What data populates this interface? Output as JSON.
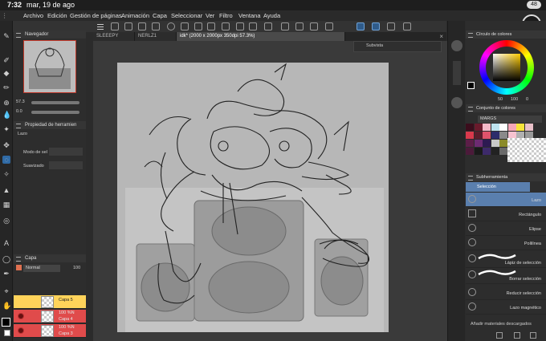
{
  "status": {
    "time": "7:32",
    "date": "mar, 19 de ago",
    "battery": "48"
  },
  "menu": [
    "Archivo",
    "Edición",
    "Gestión de páginas",
    "Animación",
    "Capa",
    "Seleccionar",
    "Ver",
    "Filtro",
    "Ventana",
    "Ayuda"
  ],
  "navigator": {
    "title": "Navegador",
    "zoom": "57.3",
    "rotation": "0.0"
  },
  "tool_property": {
    "title": "Propiedad de herramien",
    "tool_name": "Lazo",
    "mode_label": "Modo de sel",
    "smooth_label": "Suavizado"
  },
  "layers": {
    "title": "Capa",
    "blend_mode": "Normal",
    "opacity": "100",
    "rows": [
      {
        "name": "Capa 5",
        "opacity_label": ""
      },
      {
        "name": "Capa 4",
        "opacity_label": "100 %N"
      },
      {
        "name": "Capa 3",
        "opacity_label": "100 %N"
      }
    ]
  },
  "tabs": [
    {
      "label": "SLEEEPY",
      "active": false
    },
    {
      "label": "NERLZ1",
      "active": false
    },
    {
      "label": "idk* (2000 x 2000px 350dpi 57.3%)",
      "active": true
    }
  ],
  "subview": {
    "label": "Subvista"
  },
  "color_wheel": {
    "title": "Círculo de colores",
    "h": "50",
    "s": "100",
    "v": "0"
  },
  "color_set": {
    "title": "Conjunto de colores",
    "set_name": "MARGS",
    "swatches": [
      "#3b0d1c",
      "#6a1a2c",
      "#f3b8c7",
      "#bde3f0",
      "#ffffff",
      "#f6a7b8",
      "#f7e43a",
      "#e9c0c9",
      "#d9394c",
      "#5a1c2b",
      "#e0536b",
      "#2c2c6b",
      "#8a8a8a",
      "#f7c3d0",
      "#b0b0b0",
      "#999999",
      "#5c1e48",
      "#6d2b72",
      "#2d1a52",
      "#c9c9c9",
      "#8b8b2a",
      "#bfe86a",
      "#cccccc",
      "#aaaaaa",
      "#4b1a3a",
      "#1a1a1a",
      "#3d2a6a",
      "#222222",
      "#6a6a6a",
      "#9a6b3a",
      "#dddddd",
      "#bbbbbb"
    ]
  },
  "sub_tool": {
    "title": "Subherramienta",
    "group": "Selección",
    "items": [
      "Lazo",
      "Rectángulo",
      "Elipse",
      "Polilínea",
      "Lápiz de selección",
      "Borrar selección",
      "Reducir selección",
      "Lazo magnético"
    ],
    "selected": "Lazo",
    "footer": "Añadir materiales descargados"
  },
  "colors": {
    "accent": "#2f6aa5",
    "selection": "#5a7fae",
    "layer_red": "#e04b4b",
    "layer_yellow": "#ffd35a"
  }
}
